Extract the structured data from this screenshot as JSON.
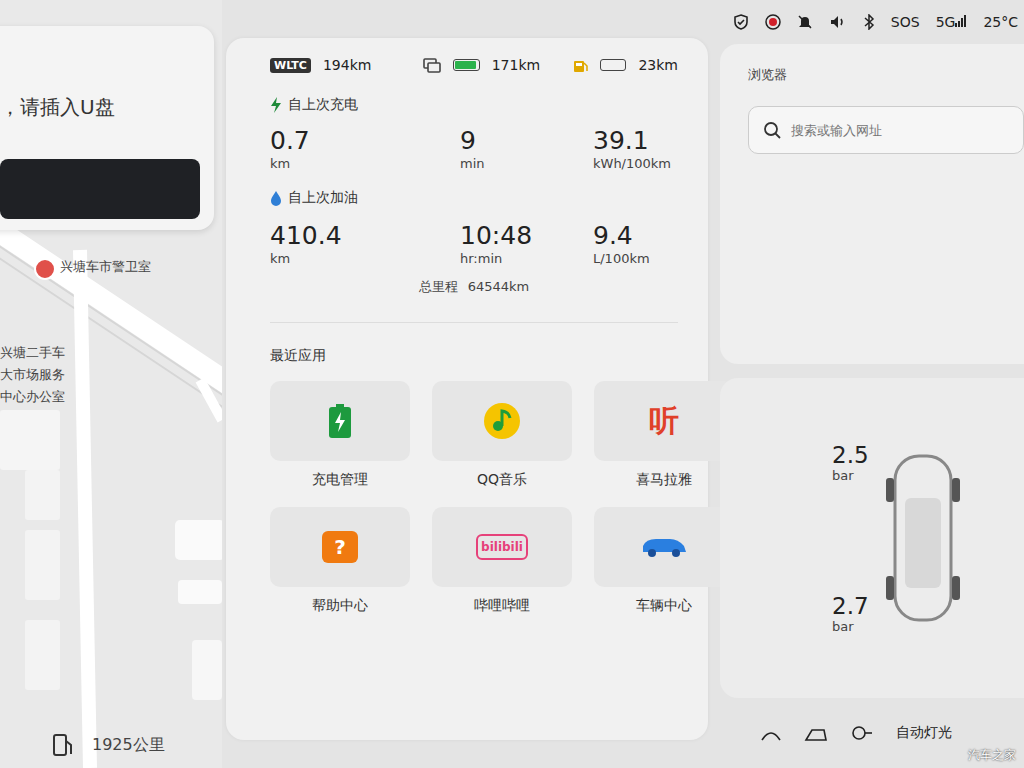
{
  "status_bar": {
    "sos": "SOS",
    "network": "5G",
    "temperature": "25°C"
  },
  "left": {
    "notice": "，请插入U盘",
    "map_labels": [
      {
        "text": "兴塘车市警卫室"
      },
      {
        "text": "兴塘二手车"
      },
      {
        "text": "大市场服务"
      },
      {
        "text": "中心办公室"
      }
    ],
    "distance": "1925公里"
  },
  "ranges": {
    "wltc": {
      "label": "WLTC",
      "value": "194km"
    },
    "electric": {
      "value": "171km",
      "level": 0.92
    },
    "fuel": {
      "value": "23km",
      "level": 0.0
    }
  },
  "since_charge": {
    "title": "自上次充电",
    "stats": [
      {
        "value": "0.7",
        "unit": "km"
      },
      {
        "value": "9",
        "unit": "min"
      },
      {
        "value": "39.1",
        "unit": "kWh/100km"
      }
    ]
  },
  "since_refuel": {
    "title": "自上次加油",
    "stats": [
      {
        "value": "410.4",
        "unit": "km"
      },
      {
        "value": "10:48",
        "unit": "hr:min"
      },
      {
        "value": "9.4",
        "unit": "L/100km"
      }
    ]
  },
  "odometer": {
    "label": "总里程",
    "value": "64544km"
  },
  "recent_apps": {
    "title": "最近应用",
    "apps": [
      {
        "label": "充电管理",
        "kind": "battery",
        "glyph": ""
      },
      {
        "label": "QQ音乐",
        "kind": "note",
        "glyph": ""
      },
      {
        "label": "喜马拉雅",
        "kind": "glyph",
        "glyph": "听"
      },
      {
        "label": "帮助中心",
        "kind": "badge",
        "glyph": "?"
      },
      {
        "label": "哔哩哔哩",
        "kind": "tv",
        "glyph": "bilibili"
      },
      {
        "label": "车辆中心",
        "kind": "car",
        "glyph": ""
      }
    ]
  },
  "browser": {
    "title": "浏览器",
    "placeholder": "搜索或输入网址"
  },
  "tires": [
    {
      "pressure": "2.5",
      "unit": "bar"
    },
    {
      "pressure": "2.7",
      "unit": "bar"
    }
  ],
  "bottom_bar": {
    "auto_light": "自动灯光"
  },
  "watermark": "汽车之家"
}
